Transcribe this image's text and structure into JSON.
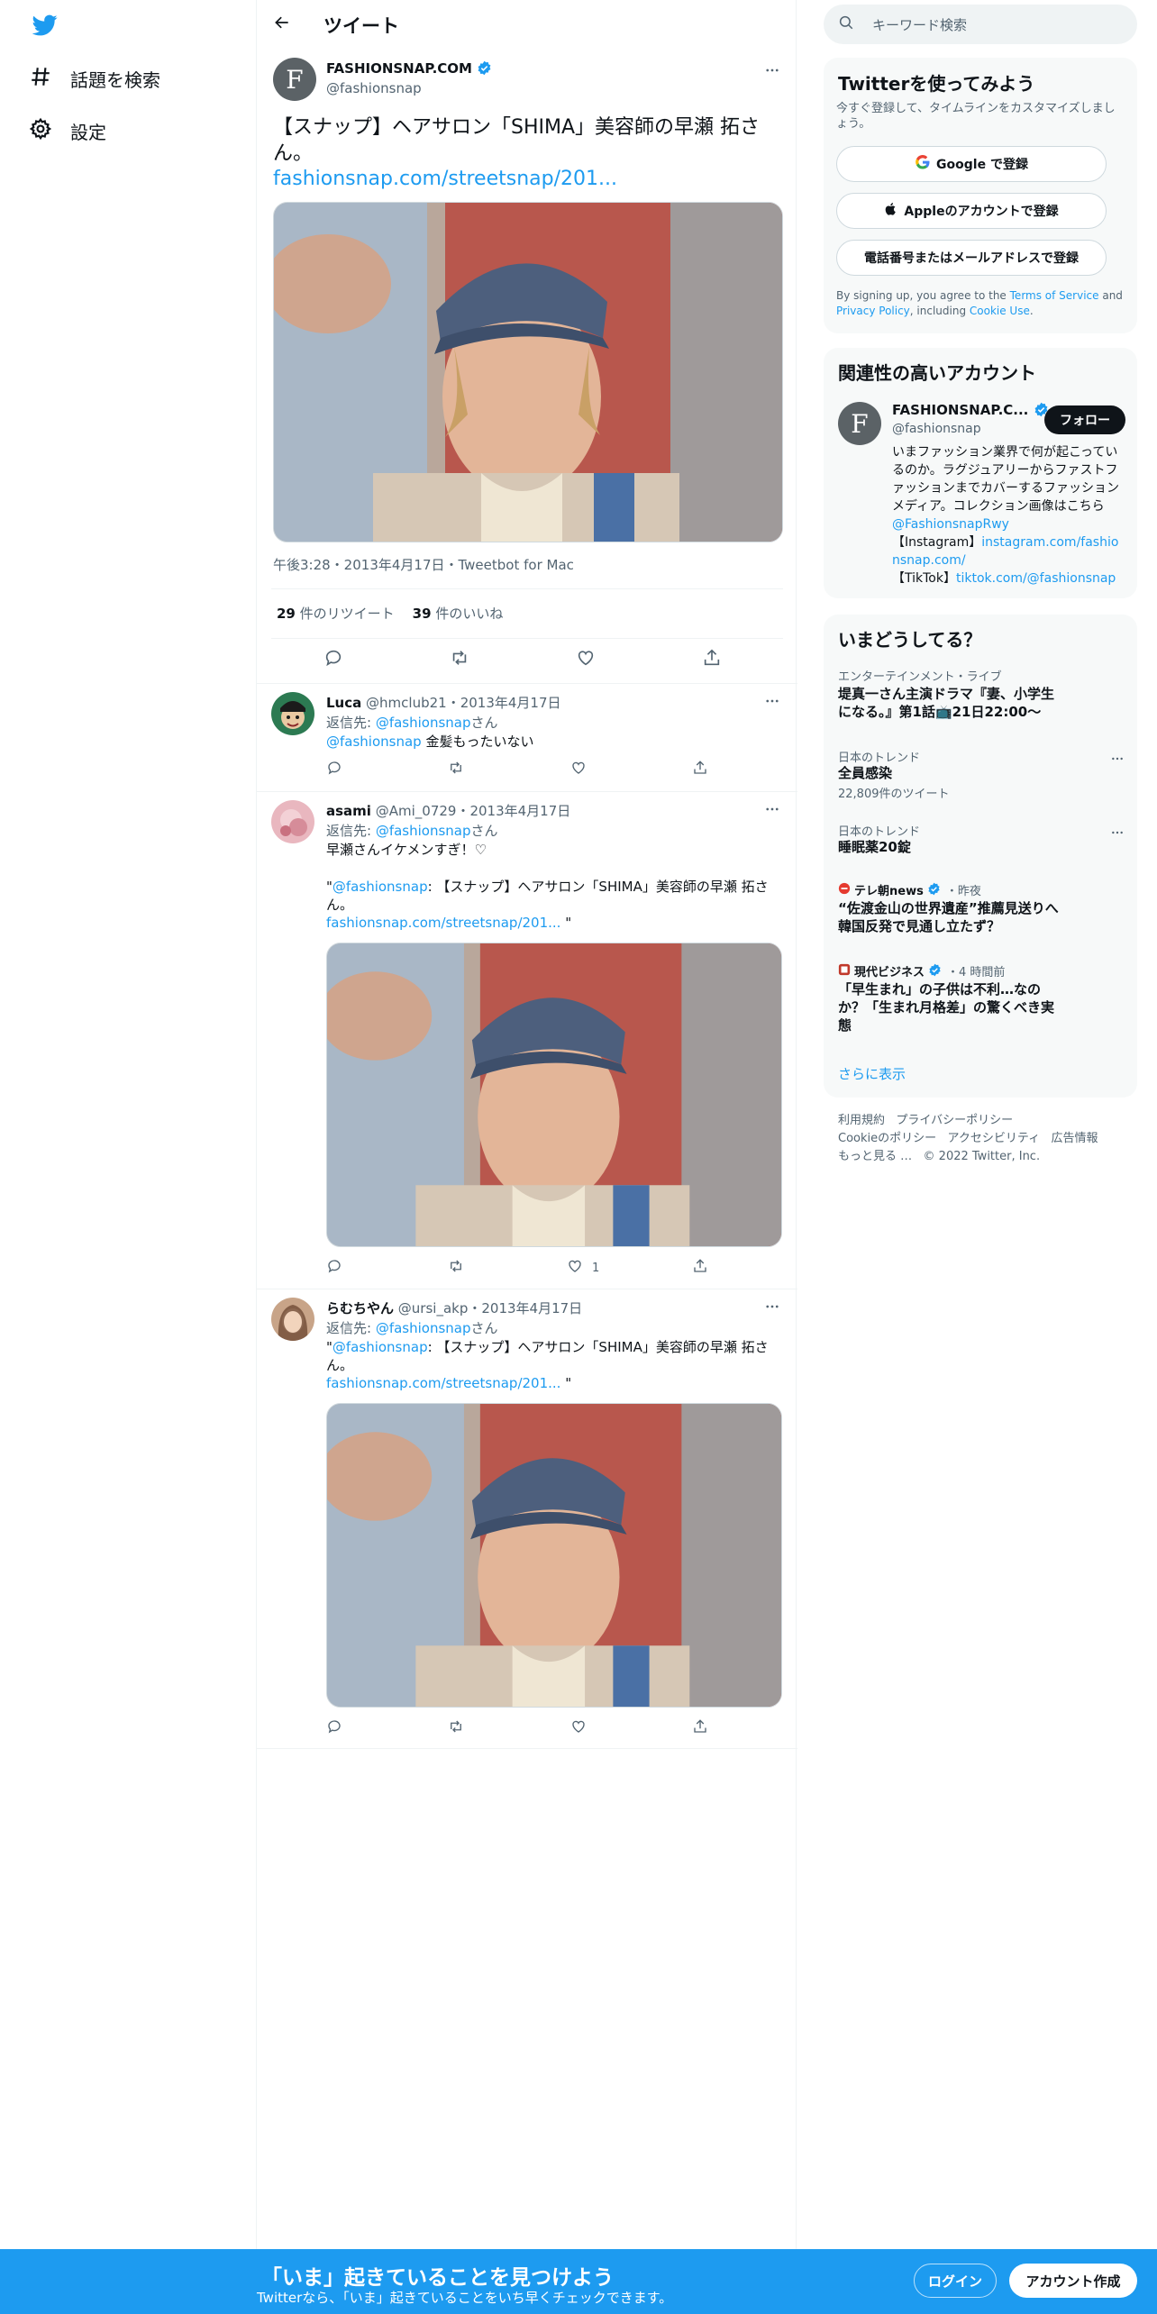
{
  "nav": {
    "explore_label": "話題を検索",
    "settings_label": "設定"
  },
  "header": {
    "title": "ツイート"
  },
  "main_tweet": {
    "author_name": "FASHIONSNAP.COM",
    "handle": "@fashionsnap",
    "text": "【スナップ】ヘアサロン「SHIMA」美容師の早瀬 拓さん。",
    "link": "fashionsnap.com/streetsnap/201...",
    "meta": "午後3:28・2013年4月17日・Tweetbot for Mac",
    "retweets_count": "29",
    "retweets_label": "件のリツイート",
    "likes_count": "39",
    "likes_label": "件のいいね"
  },
  "replies": [
    {
      "name": "Luca",
      "handle_date": "@hmclub21・2013年4月17日",
      "reply_prefix": "返信先: ",
      "reply_to": "@fashionsnap",
      "reply_suffix": "さん",
      "mention": "@fashionsnap",
      "text": " 金髪もったいない"
    },
    {
      "name": "asami",
      "handle_date": "@Ami_0729・2013年4月17日",
      "reply_prefix": "返信先: ",
      "reply_to": "@fashionsnap",
      "reply_suffix": "さん",
      "text": "早瀬さんイケメンすぎ！♡",
      "quote_open": "\"",
      "quote_mention": "@fashionsnap",
      "quote_text": ": 【スナップ】ヘアサロン「SHIMA」美容師の早瀬 拓さん。",
      "quote_link": "fashionsnap.com/streetsnap/201...",
      "quote_close": " \"",
      "likes": "1"
    },
    {
      "name": "らむちやん",
      "handle_date": "@ursi_akp・2013年4月17日",
      "reply_prefix": "返信先: ",
      "reply_to": "@fashionsnap",
      "reply_suffix": "さん",
      "quote_open": "\"",
      "quote_mention": "@fashionsnap",
      "quote_text": ": 【スナップ】ヘアサロン「SHIMA」美容師の早瀬 拓さん。",
      "quote_link": "fashionsnap.com/streetsnap/201...",
      "quote_close": " \""
    }
  ],
  "search": {
    "placeholder": "キーワード検索"
  },
  "signup_panel": {
    "title": "Twitterを使ってみよう",
    "subtitle": "今すぐ登録して、タイムラインをカスタマイズしましょう。",
    "google": "Google で登録",
    "apple": "Appleのアカウントで登録",
    "phone": "電話番号またはメールアドレスで登録",
    "terms_pre": "By signing up, you agree to the ",
    "terms_link": "Terms of Service",
    "terms_and": " and ",
    "privacy_link": "Privacy Policy",
    "terms_including": ", including ",
    "cookie_link": "Cookie Use",
    "terms_end": "."
  },
  "related": {
    "title": "関連性の高いアカウント",
    "name": "FASHIONSNAP.C...",
    "handle": "@fashionsnap",
    "follow": "フォロー",
    "bio1": "いまファッション業界で何が起こっているのか。ラグジュアリーからファストファッションまでカバーするファッションメディア。コレクション画像はこちら ",
    "bio_mention": "@FashionsnapRwy",
    "bio_ig_label": "【Instagram】",
    "bio_ig_link": "instagram.com/fashionsnap.com/",
    "bio_tt_label": "【TikTok】",
    "bio_tt_link": "tiktok.com/@fashionsnap"
  },
  "trends": {
    "title": "いまどうしてる？",
    "items": [
      {
        "category": "エンターテインメント・ライブ",
        "name": "堤真一さん主演ドラマ『妻、小学生になる。』第1話📺21日22:00〜"
      },
      {
        "category": "日本のトレンド",
        "name": "全員感染",
        "count": "22,809件のツイート"
      },
      {
        "category": "日本のトレンド",
        "name": "睡眠薬20錠"
      },
      {
        "source": "テレ朝news",
        "time": "・昨夜",
        "name": "“佐渡金山の世界遺産”推薦見送りへ　韓国反発で見通し立たず？"
      },
      {
        "source": "現代ビジネス",
        "time": "・4 時間前",
        "name": "「早生まれ」の子供は不利…なのか？「生まれ月格差」の驚くべき実態"
      }
    ],
    "show_more": "さらに表示"
  },
  "footer": {
    "terms": "利用規約",
    "privacy": "プライバシーポリシー",
    "cookie": "Cookieのポリシー",
    "accessibility": "アクセシビリティ",
    "ads": "広告情報",
    "more": "もっと見る …",
    "copyright": "© 2022 Twitter, Inc."
  },
  "bottom_bar": {
    "title": "「いま」起きていることを見つけよう",
    "subtitle": "Twitterなら、「いま」起きていることをいち早くチェックできます。",
    "login": "ログイン",
    "signup": "アカウント作成"
  },
  "colors": {
    "accent": "#1d9bf0",
    "text": "#0f1419",
    "muted": "#536471"
  }
}
